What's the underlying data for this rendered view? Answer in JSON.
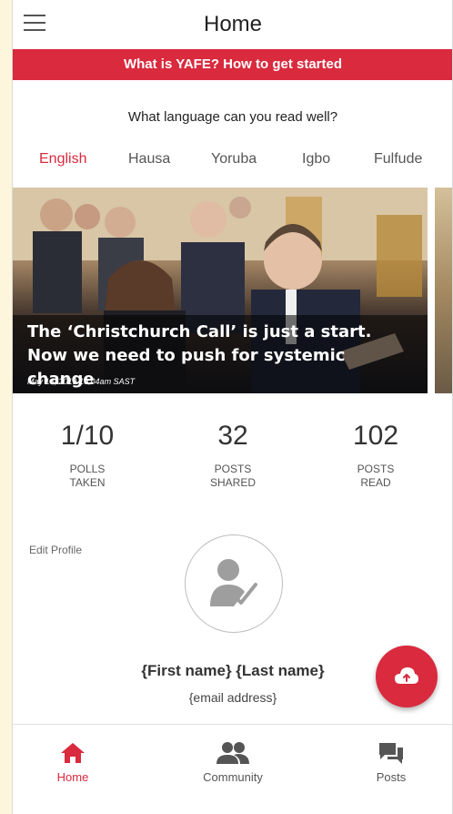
{
  "app_bar": {
    "title": "Home",
    "menu_icon": "hamburger-menu-icon"
  },
  "banner": {
    "text": "What is YAFE? How to get started"
  },
  "language_picker": {
    "question": "What language can you read well?",
    "languages": [
      "English",
      "Hausa",
      "Yoruba",
      "Igbo",
      "Fulfude"
    ],
    "selected": "English"
  },
  "featured_post": {
    "title": "The ‘Christchurch Call’ is just a start. Now we need to push for systemic change",
    "date": "May 16, 2019 10.04am SAST"
  },
  "stats": [
    {
      "value": "1/10",
      "label": "POLLS\nTAKEN"
    },
    {
      "value": "32",
      "label": "POSTS\nSHARED"
    },
    {
      "value": "102",
      "label": "POSTS\nREAD"
    }
  ],
  "profile": {
    "edit_label": "Edit Profile",
    "name": "{First name} {Last name}",
    "email": "{email address}",
    "avatar_icon": "user-check-icon"
  },
  "fab": {
    "icon": "cloud-upload-icon"
  },
  "bottom_nav": {
    "items": [
      {
        "label": "Home",
        "icon": "home-icon",
        "active": true
      },
      {
        "label": "Community",
        "icon": "people-icon",
        "active": false
      },
      {
        "label": "Posts",
        "icon": "chat-bubbles-icon",
        "active": false
      }
    ]
  },
  "colors": {
    "accent": "#d92a3e",
    "text": "#333333",
    "muted": "#555555"
  }
}
